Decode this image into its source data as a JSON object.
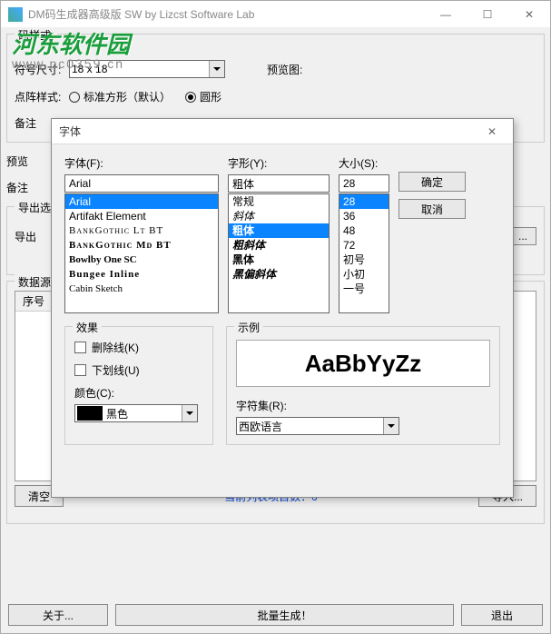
{
  "main": {
    "title": "DM码生成器高级版 SW  by Lizcst Software Lab",
    "watermark_cn": "河东软件园",
    "watermark_url": "www.pc0359.cn",
    "style_label": "码样式:",
    "size_label": "符号尺寸:",
    "size_value": "18 x 18",
    "preview_label": "预览图:",
    "dot_label": "点阵样式:",
    "radio_square": "标准方形（默认）",
    "radio_circle": "圆形",
    "remark_label": "备注",
    "preview2_label": "预览",
    "remark2_label": "备注",
    "export_group": "导出选",
    "export_btn_lbl": "导出",
    "export_ellipsis": "...",
    "datasrc_group": "数据源",
    "col_header": "序号",
    "clear_btn": "清空",
    "status_text": "当前列表项目数：0",
    "import_btn": "导入...",
    "about_btn": "关于...",
    "batch_btn": "批量生成！",
    "exit_btn": "退出"
  },
  "font": {
    "dialog_title": "字体",
    "font_label": "字体(F):",
    "font_value": "Arial",
    "fonts": [
      "Arial",
      "Artifakt Element",
      "BankGothic Lt BT",
      "BankGothic Md BT",
      "Bowlby One SC",
      "Bungee Inline",
      "Cabin Sketch"
    ],
    "style_label": "字形(Y):",
    "style_value": "粗体",
    "styles": [
      "常规",
      "斜体",
      "粗体",
      "粗斜体",
      "黑体",
      "黑偏斜体"
    ],
    "size_label": "大小(S):",
    "size_value": "28",
    "sizes": [
      "28",
      "36",
      "48",
      "72",
      "初号",
      "小初",
      "一号"
    ],
    "ok_btn": "确定",
    "cancel_btn": "取消",
    "effects_title": "效果",
    "strike_label": "删除线(K)",
    "underline_label": "下划线(U)",
    "color_label": "颜色(C):",
    "color_value": "黑色",
    "sample_title": "示例",
    "sample_text": "AaBbYyZz",
    "charset_label": "字符集(R):",
    "charset_value": "西欧语言"
  }
}
